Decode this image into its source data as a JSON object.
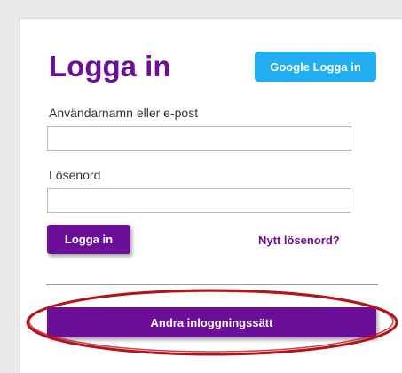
{
  "login": {
    "title": "Logga in",
    "google_button": "Google Logga in",
    "username_label": "Användarnamn eller e-post",
    "username_value": "",
    "password_label": "Lösenord",
    "password_value": "",
    "submit_button": "Logga in",
    "forgot_link": "Nytt lösenord?",
    "other_methods_button": "Andra inloggningssätt"
  },
  "colors": {
    "brand_purple": "#6b0f99",
    "google_blue": "#20aef0",
    "annotation_red": "#b3141c"
  }
}
